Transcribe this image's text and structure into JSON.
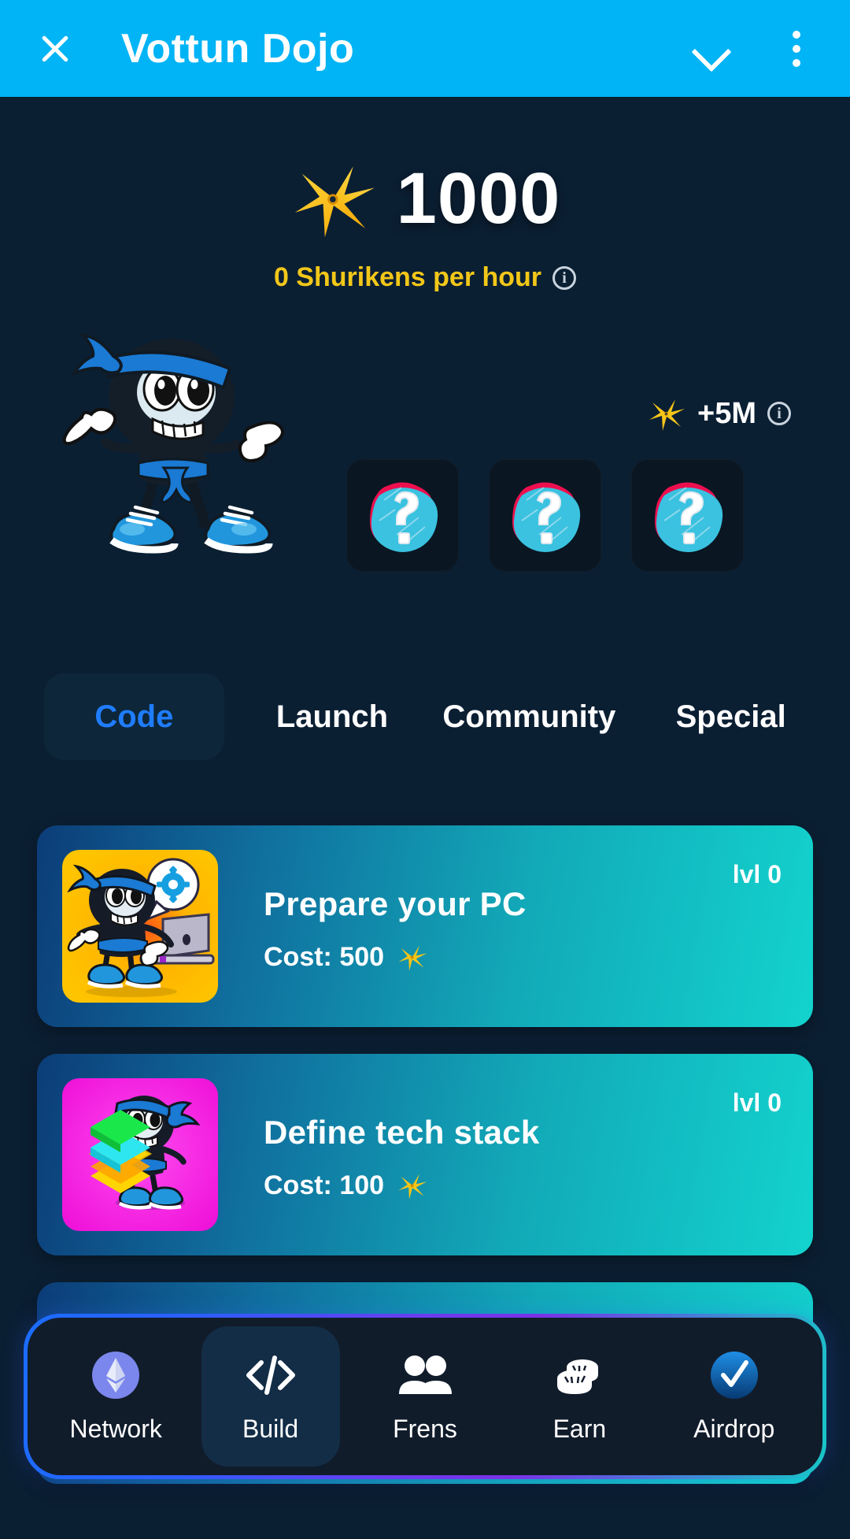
{
  "header": {
    "title": "Vottun Dojo",
    "close_icon": "close-icon",
    "chevron_icon": "chevron-down-icon",
    "menu_icon": "more-vertical-icon",
    "background_color": "#00b4f5"
  },
  "balance": {
    "amount": "1000",
    "coin_icon": "shuriken-icon",
    "rate_text": "0 Shurikens per hour",
    "rate_info_icon": "info-icon",
    "rate_color": "#f2c718"
  },
  "character": {
    "name": "ninja-mascot",
    "headband_color": "#1a7ad4",
    "body_color": "#101820",
    "shoe_color": "#2196dd"
  },
  "bonus": {
    "label": "+5M",
    "coin_icon": "shuriken-icon",
    "info_icon": "info-icon"
  },
  "mystery_cards": [
    {
      "name": "mystery-card-1",
      "icon": "question-mark-icon"
    },
    {
      "name": "mystery-card-2",
      "icon": "question-mark-icon"
    },
    {
      "name": "mystery-card-3",
      "icon": "question-mark-icon"
    }
  ],
  "tabs": {
    "active_color": "#1f7dff",
    "items": [
      {
        "label": "Code",
        "active": true
      },
      {
        "label": "Launch",
        "active": false
      },
      {
        "label": "Community",
        "active": false
      },
      {
        "label": "Special",
        "active": false
      }
    ]
  },
  "tasks": [
    {
      "title": "Prepare your PC",
      "cost_label": "Cost: 500",
      "level_label": "lvl 0",
      "thumb_name": "ninja-laptop-thumbnail",
      "thumb_bg_start": "#ffc400",
      "thumb_bg_end": "#f0a000"
    },
    {
      "title": "Define tech stack",
      "cost_label": "Cost: 100",
      "level_label": "lvl 0",
      "thumb_name": "ninja-layers-thumbnail",
      "thumb_bg_start": "#ff24e0",
      "thumb_bg_end": "#e915d6"
    },
    {
      "title": "",
      "cost_label": "",
      "level_label": "",
      "thumb_name": "task-thumbnail-hidden",
      "thumb_bg_start": "#0c3d78",
      "thumb_bg_end": "#13d3cd"
    }
  ],
  "bottom_nav": {
    "items": [
      {
        "label": "Network",
        "icon": "ethereum-icon",
        "active": false
      },
      {
        "label": "Build",
        "icon": "code-brackets-icon",
        "active": true
      },
      {
        "label": "Frens",
        "icon": "people-icon",
        "active": false
      },
      {
        "label": "Earn",
        "icon": "coins-icon",
        "active": false
      },
      {
        "label": "Airdrop",
        "icon": "check-circle-icon",
        "active": false
      }
    ]
  }
}
